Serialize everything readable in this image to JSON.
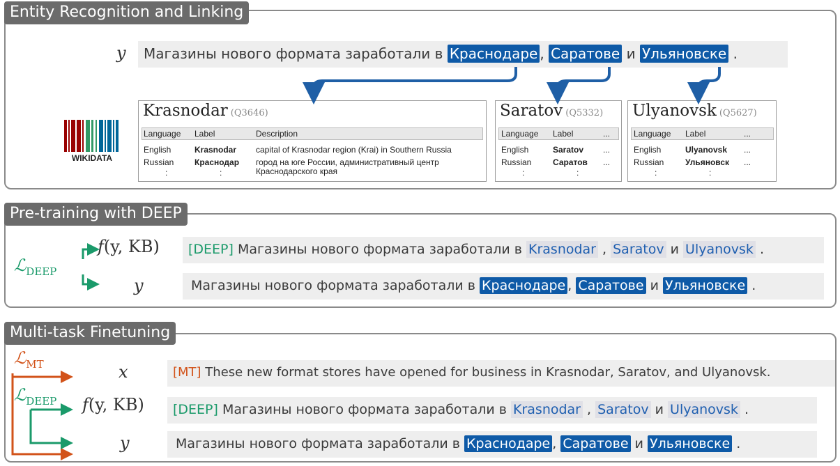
{
  "panels": {
    "entity": {
      "title": "Entity Recognition and Linking"
    },
    "pretrain": {
      "title": "Pre-training with DEEP"
    },
    "multitask": {
      "title": "Multi-task Finetuning"
    }
  },
  "vars": {
    "y": "y",
    "x": "x",
    "f_prefix": "f",
    "f_args": "(y, ",
    "kb": "KB",
    "close": ")"
  },
  "losses": {
    "L": "ℒ",
    "deep_sub": "DEEP",
    "mt_sub": "MT"
  },
  "sentence": {
    "prefix": "Магазины нового формата заработали в ",
    "e1": "Краснодаре",
    "sep1": ", ",
    "e2": "Саратове",
    "sep2": " и ",
    "e3": "Ульяновске",
    "end": " ."
  },
  "deep_sentence": {
    "tag": "[DEEP]",
    "prefix": " Магазины нового формата заработали в ",
    "e1": "Krasnodar",
    "sep1": " , ",
    "e2": "Saratov",
    "sep2": " и ",
    "e3": "Ulyanovsk",
    "end": " ."
  },
  "mt_sentence": {
    "tag": "[MT]",
    "text": " These new format stores have opened for business in Krasnodar, Saratov, and Ulyanovsk."
  },
  "wikidata": {
    "label": "WIKIDATA",
    "bar_colors": [
      "#990000",
      "#339966",
      "#006699"
    ]
  },
  "kb_entries": [
    {
      "name": "Krasnodar",
      "qid": "(Q3646)",
      "headers": [
        "Language",
        "Label",
        "Description"
      ],
      "rows": [
        [
          "English",
          "Krasnodar",
          "capital of Krasnodar region (Krai) in Southern Russia"
        ],
        [
          "Russian",
          "Краснодар",
          "город на юге России, административный центр"
        ],
        [
          "",
          "",
          "Краснодарского края"
        ],
        [
          ":",
          ":",
          ""
        ]
      ]
    },
    {
      "name": "Saratov",
      "qid": "(Q5332)",
      "headers": [
        "Language",
        "Label",
        "..."
      ],
      "rows": [
        [
          "English",
          "Saratov",
          "..."
        ],
        [
          "Russian",
          "Саратов",
          "..."
        ],
        [
          ":",
          ":",
          ""
        ]
      ]
    },
    {
      "name": "Ulyanovsk",
      "qid": "(Q5627)",
      "headers": [
        "Language",
        "Label",
        "..."
      ],
      "rows": [
        [
          "English",
          "Ulyanovsk",
          "..."
        ],
        [
          "Russian",
          "Ульяновск",
          "..."
        ],
        [
          ":",
          ":",
          ""
        ]
      ]
    }
  ],
  "colors": {
    "entity_blue": "#0e5aa7",
    "arrow_blue": "#1f5fa6",
    "deep_green": "#1a9a6a",
    "mt_orange": "#d2531a",
    "panel_border": "#8a8a8a"
  }
}
